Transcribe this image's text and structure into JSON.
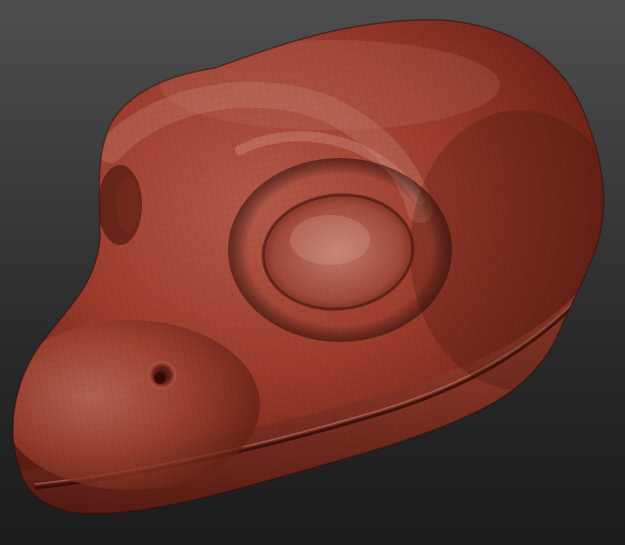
{
  "scene": {
    "subject": "sculpted-reptile-head",
    "material_color": "#9c3b2c",
    "highlight_color": "#c9857a",
    "shadow_color": "#3d120c",
    "background_top": "#4e4e4e",
    "background_bottom": "#1c1c1c"
  }
}
